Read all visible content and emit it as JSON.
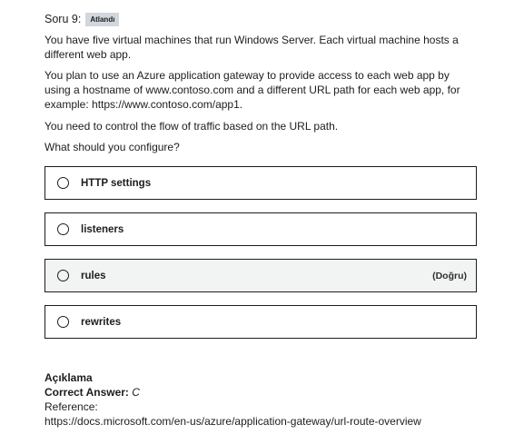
{
  "question": {
    "label": "Soru 9:",
    "status_badge": "Atlandı",
    "paragraphs": [
      "You have five virtual machines that run Windows Server. Each virtual machine hosts a different web app.",
      "You plan to use an Azure application gateway to provide access to each web app by using a hostname of www.contoso.com and a different URL path for each web app, for example: https://www.contoso.com/app1.",
      "You need to control the flow of traffic based on the URL path.",
      "What should you configure?"
    ]
  },
  "options": [
    {
      "label": "HTTP settings",
      "tag": "",
      "correct": false
    },
    {
      "label": "listeners",
      "tag": "",
      "correct": false
    },
    {
      "label": "rules",
      "tag": "(Doğru)",
      "correct": true
    },
    {
      "label": "rewrites",
      "tag": "",
      "correct": false
    }
  ],
  "explanation": {
    "title": "Açıklama",
    "correct_label": "Correct Answer:",
    "correct_value": "C",
    "reference_label": "Reference:",
    "reference_url": "https://docs.microsoft.com/en-us/azure/application-gateway/url-route-overview"
  }
}
